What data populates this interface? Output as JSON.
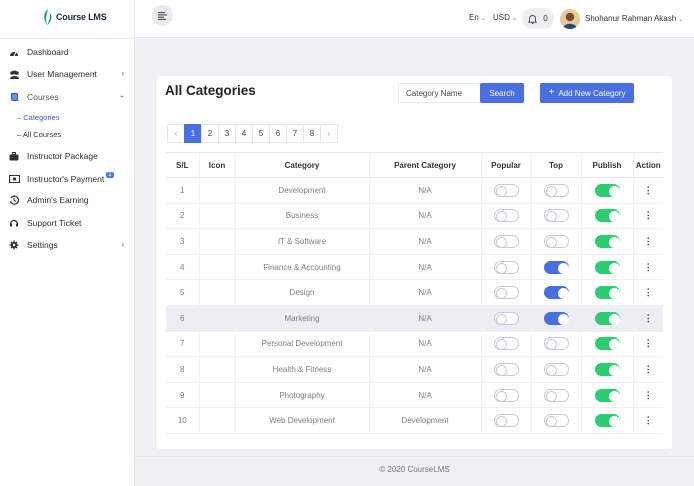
{
  "app": {
    "logo_text": "Course LMS"
  },
  "sidebar": {
    "items": [
      {
        "label": "Dashboard",
        "icon": "dashboard-icon"
      },
      {
        "label": "User Management",
        "icon": "users-icon"
      },
      {
        "label": "Courses",
        "icon": "book-icon"
      },
      {
        "label": "Instructor Package",
        "icon": "briefcase-icon"
      },
      {
        "label": "Instructor's Payment",
        "icon": "payment-icon",
        "badge": "1"
      },
      {
        "label": "Admin's Earning",
        "icon": "history-icon"
      },
      {
        "label": "Support Ticket",
        "icon": "support-icon"
      },
      {
        "label": "Settings",
        "icon": "gear-icon"
      }
    ],
    "courses_sub": [
      "– Categories",
      "– All Courses"
    ]
  },
  "header": {
    "language": "En",
    "currency": "USD",
    "notification_count": "0",
    "user_name": "Shohanur Rahman Akash"
  },
  "page": {
    "title": "All Categories",
    "search_placeholder": "Category Name",
    "search_label": "Search",
    "add_label": "Add New Category"
  },
  "pagination": {
    "prev": "‹",
    "pages": [
      "1",
      "2",
      "3",
      "4",
      "5",
      "6",
      "7",
      "8"
    ],
    "current": "1",
    "next": "›"
  },
  "table": {
    "columns": [
      "S/L",
      "Icon",
      "Category",
      "Parent Category",
      "Popular",
      "Top",
      "Publish",
      "Action"
    ],
    "rows": [
      {
        "sl": "1",
        "category": "Development",
        "parent": "N/A",
        "popular": false,
        "top": false,
        "publish": true
      },
      {
        "sl": "2",
        "category": "Business",
        "parent": "N/A",
        "popular": false,
        "top": false,
        "publish": true
      },
      {
        "sl": "3",
        "category": "IT & Software",
        "parent": "N/A",
        "popular": false,
        "top": false,
        "publish": true
      },
      {
        "sl": "4",
        "category": "Finance & Accounting",
        "parent": "N/A",
        "popular": false,
        "top": true,
        "publish": true
      },
      {
        "sl": "5",
        "category": "Design",
        "parent": "N/A",
        "popular": false,
        "top": true,
        "publish": true
      },
      {
        "sl": "6",
        "category": "Marketing",
        "parent": "N/A",
        "popular": false,
        "top": true,
        "publish": true
      },
      {
        "sl": "7",
        "category": "Personal Development",
        "parent": "N/A",
        "popular": false,
        "top": false,
        "publish": true
      },
      {
        "sl": "8",
        "category": "Health & Fitness",
        "parent": "N/A",
        "popular": false,
        "top": false,
        "publish": true
      },
      {
        "sl": "9",
        "category": "Photography",
        "parent": "N/A",
        "popular": false,
        "top": false,
        "publish": true
      },
      {
        "sl": "10",
        "category": "Web Development",
        "parent": "Development",
        "popular": false,
        "top": false,
        "publish": true
      }
    ],
    "highlighted_row": "6",
    "action_glyph": "⋮"
  },
  "footer": {
    "text": "© 2020 CourseLMS"
  },
  "colors": {
    "primary": "#4a6fe0",
    "publish_on": "#2ecc71",
    "top_on": "#4a6fe0"
  }
}
